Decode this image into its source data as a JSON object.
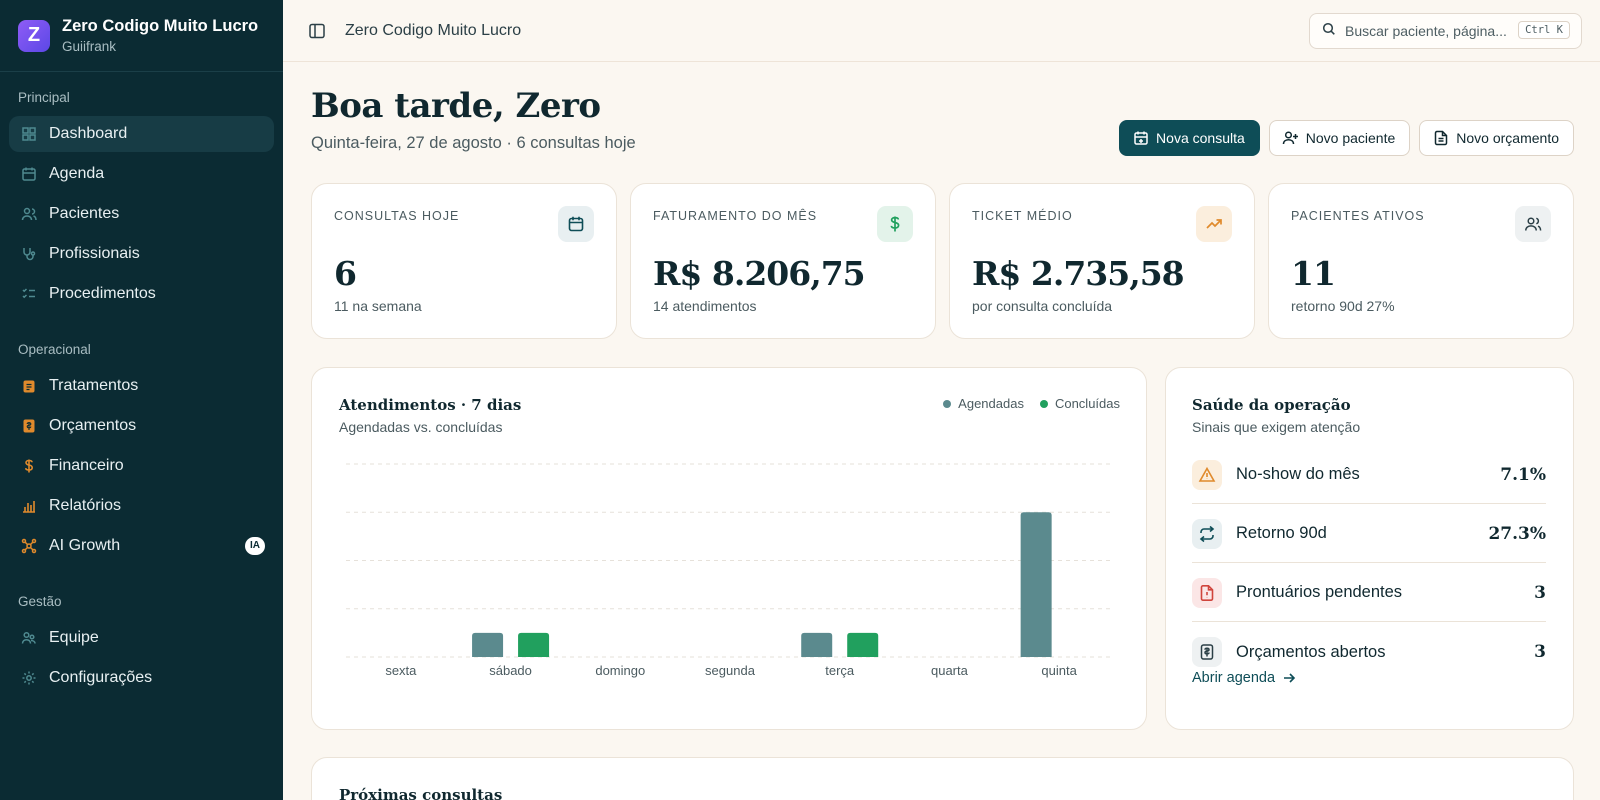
{
  "sidebar": {
    "brand_name": "Zero Codigo Muito Lucro",
    "brand_user": "Guiifrank",
    "logo_letter": "Z",
    "sections": [
      {
        "title": "Principal",
        "items": [
          {
            "label": "Dashboard",
            "icon": "grid-icon"
          },
          {
            "label": "Agenda",
            "icon": "calendar-icon"
          },
          {
            "label": "Pacientes",
            "icon": "users-icon"
          },
          {
            "label": "Profissionais",
            "icon": "stethoscope-icon"
          },
          {
            "label": "Procedimentos",
            "icon": "list-icon"
          }
        ]
      },
      {
        "title": "Operacional",
        "items": [
          {
            "label": "Tratamentos",
            "icon": "clipboard-icon"
          },
          {
            "label": "Orçamentos",
            "icon": "receipt-icon"
          },
          {
            "label": "Financeiro",
            "icon": "dollar-icon"
          },
          {
            "label": "Relatórios",
            "icon": "bar-chart-icon"
          },
          {
            "label": "AI Growth",
            "icon": "network-icon",
            "badge": "IA"
          }
        ]
      },
      {
        "title": "Gestão",
        "items": [
          {
            "label": "Equipe",
            "icon": "team-icon"
          },
          {
            "label": "Configurações",
            "icon": "settings-icon"
          }
        ]
      }
    ]
  },
  "header": {
    "title": "Zero Codigo Muito Lucro",
    "search_placeholder": "Buscar paciente, página...",
    "shortcut": "Ctrl K"
  },
  "main": {
    "greeting": "Boa tarde, Zero",
    "subtitle": "Quinta-feira, 27 de agosto · 6 consultas hoje",
    "actions": {
      "new_appointment": "Nova consulta",
      "new_patient": "Novo paciente",
      "new_budget": "Novo orçamento"
    },
    "kpis": [
      {
        "label": "CONSULTAS HOJE",
        "value": "6",
        "sub": "11 na semana",
        "icon": "calendar-icon"
      },
      {
        "label": "FATURAMENTO DO MÊS",
        "value": "R$ 8.206,75",
        "sub": "14 atendimentos",
        "icon": "dollar-icon"
      },
      {
        "label": "TICKET MÉDIO",
        "value": "R$ 2.735,58",
        "sub": "por consulta concluída",
        "icon": "trending-up-icon"
      },
      {
        "label": "PACIENTES ATIVOS",
        "value": "11",
        "sub": "retorno 90d 27%",
        "icon": "users-icon"
      }
    ],
    "health": {
      "title": "Saúde da operação",
      "subtitle": "Sinais que exigem atenção",
      "rows": [
        {
          "label": "No-show do mês",
          "value": "7.1%",
          "icon": "alert-triangle-icon"
        },
        {
          "label": "Retorno 90d",
          "value": "27.3%",
          "icon": "repeat-icon"
        },
        {
          "label": "Prontuários pendentes",
          "value": "3",
          "icon": "file-alert-icon"
        },
        {
          "label": "Orçamentos abertos",
          "value": "3",
          "icon": "receipt-icon"
        }
      ],
      "link": "Abrir agenda"
    },
    "next_title": "Próximas consultas"
  },
  "colors": {
    "sidebar_bg": "#0b2b33",
    "primary": "#0e4d57",
    "scheduled": "#5b8a8e",
    "completed": "#21a05e"
  },
  "chart_data": {
    "type": "bar",
    "title": "Atendimentos · 7 dias",
    "subtitle": "Agendadas vs. concluídas",
    "categories": [
      "sexta",
      "sábado",
      "domingo",
      "segunda",
      "terça",
      "quarta",
      "quinta"
    ],
    "series": [
      {
        "name": "Agendadas",
        "values": [
          0,
          1,
          0,
          0,
          1,
          0,
          6
        ],
        "color": "#5b8a8e"
      },
      {
        "name": "Concluídas",
        "values": [
          0,
          1,
          0,
          0,
          1,
          0,
          0
        ],
        "color": "#21a05e"
      }
    ],
    "ylim": [
      0,
      8
    ],
    "grid": true,
    "legend": "top-right"
  }
}
